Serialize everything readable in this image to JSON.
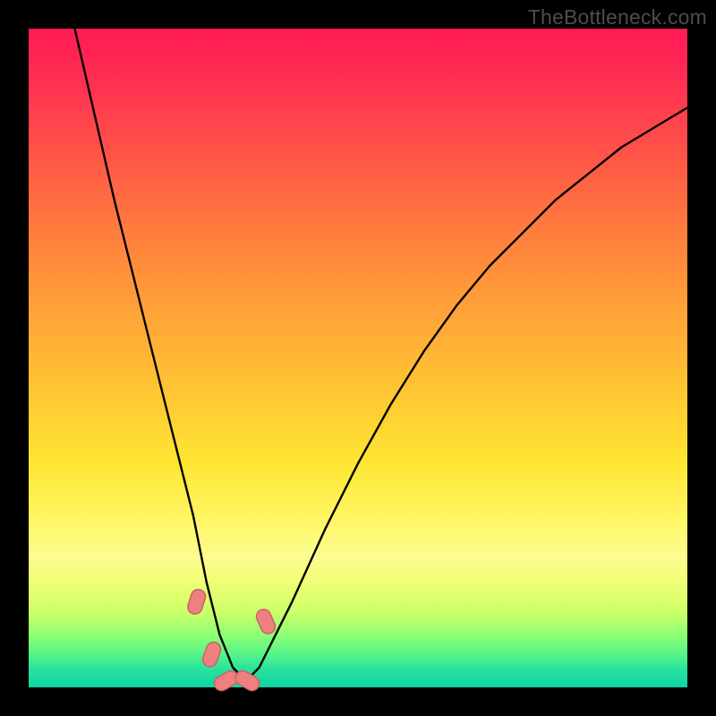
{
  "watermark": "TheBottleneck.com",
  "colors": {
    "frame": "#000000",
    "curve_stroke": "#000000",
    "marker_fill": "#f08080",
    "marker_stroke": "#c86464",
    "watermark_text": "#4d4d4d"
  },
  "chart_data": {
    "type": "line",
    "title": "",
    "xlabel": "",
    "ylabel": "",
    "xlim": [
      0,
      100
    ],
    "ylim": [
      0,
      100
    ],
    "grid": false,
    "note": "Axes have no visible tick labels; x/y are normalized 0–100. y=100 at top of gradient area, y=0 at bottom.",
    "series": [
      {
        "name": "bottleneck-curve",
        "x": [
          7,
          10,
          13,
          16,
          19,
          22,
          25,
          27,
          29,
          31,
          33,
          35,
          40,
          45,
          50,
          55,
          60,
          65,
          70,
          75,
          80,
          85,
          90,
          95,
          100
        ],
        "y": [
          100,
          87,
          74,
          62,
          50,
          38,
          26,
          16,
          8,
          3,
          1,
          3,
          13,
          24,
          34,
          43,
          51,
          58,
          64,
          69,
          74,
          78,
          82,
          85,
          88
        ]
      }
    ],
    "markers": [
      {
        "name": "pt-left-upper",
        "x": 25.5,
        "y": 13
      },
      {
        "name": "pt-left-lower",
        "x": 27.8,
        "y": 5
      },
      {
        "name": "pt-bottom-left",
        "x": 30.0,
        "y": 1
      },
      {
        "name": "pt-bottom-right",
        "x": 33.2,
        "y": 1
      },
      {
        "name": "pt-right-upper",
        "x": 36.0,
        "y": 10
      }
    ]
  }
}
